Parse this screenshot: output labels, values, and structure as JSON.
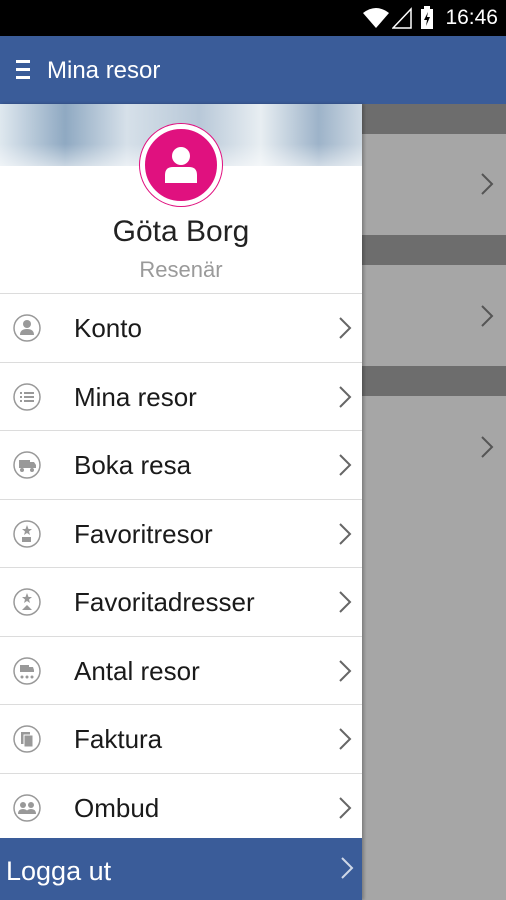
{
  "status_bar": {
    "time": "16:46"
  },
  "app_bar": {
    "title": "Mina resor",
    "menu_icon": "hamburger-icon"
  },
  "profile": {
    "name": "Göta Borg",
    "role": "Resenär",
    "avatar_color": "#e0117f"
  },
  "menu": [
    {
      "id": "konto",
      "label": "Konto",
      "icon": "account-icon"
    },
    {
      "id": "mina-resor",
      "label": "Mina resor",
      "icon": "list-icon"
    },
    {
      "id": "boka-resa",
      "label": "Boka resa",
      "icon": "vehicle-icon"
    },
    {
      "id": "favoritresor",
      "label": "Favoritresor",
      "icon": "favorite-trip-icon"
    },
    {
      "id": "favoritadresser",
      "label": "Favoritadresser",
      "icon": "favorite-address-icon"
    },
    {
      "id": "antal-resor",
      "label": "Antal resor",
      "icon": "trip-count-icon"
    },
    {
      "id": "faktura",
      "label": "Faktura",
      "icon": "invoice-icon"
    },
    {
      "id": "ombud",
      "label": "Ombud",
      "icon": "agents-icon"
    }
  ],
  "logout": {
    "label": "Logga ut"
  },
  "colors": {
    "primary": "#3a5c99",
    "accent": "#e0117f",
    "background_content": "#a6a6a6"
  }
}
